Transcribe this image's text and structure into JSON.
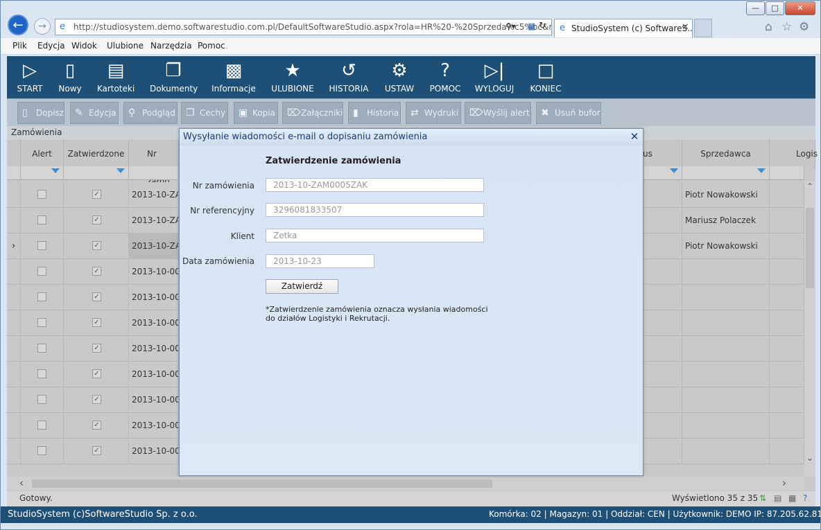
{
  "browser": {
    "url": "http://studiosystem.demo.softwarestudio.com.pl/DefaultSoftwareStudio.aspx?rola=HR%20-%20Sprzeda%c5%bc&rol",
    "tab_title": "StudioSystem (c) SoftwareS...",
    "menu": [
      "Plik",
      "Edycja",
      "Widok",
      "Ulubione",
      "Narzędzia",
      "Pomoc"
    ]
  },
  "toolbar": {
    "items": [
      {
        "label": "START",
        "icon": "play-icon"
      },
      {
        "label": "Nowy",
        "icon": "new-document-icon"
      },
      {
        "label": "Kartoteki",
        "icon": "window-list-icon"
      },
      {
        "label": "Dokumenty",
        "icon": "documents-icon"
      },
      {
        "label": "Informacje",
        "icon": "bar-chart-icon"
      },
      {
        "label": "ULUBIONE",
        "icon": "star-icon"
      },
      {
        "label": "HISTORIA",
        "icon": "history-icon"
      },
      {
        "label": "USTAW",
        "icon": "gears-icon"
      },
      {
        "label": "POMOC",
        "icon": "question-icon"
      },
      {
        "label": "WYLOGUJ",
        "icon": "logout-icon"
      },
      {
        "label": "KONIEC",
        "icon": "end-icon"
      }
    ]
  },
  "actions": [
    {
      "label": "Dopisz",
      "icon": "page-icon"
    },
    {
      "label": "Edycja",
      "icon": "edit-icon"
    },
    {
      "label": "Podgląd",
      "icon": "magnifier-icon"
    },
    {
      "label": "Cechy",
      "icon": "features-icon"
    },
    {
      "label": "Kopia",
      "icon": "copy-icon"
    },
    {
      "label": "Załączniki",
      "icon": "paperclip-icon"
    },
    {
      "label": "Historia",
      "icon": "history-icon"
    },
    {
      "label": "Wydruki",
      "icon": "print-icon"
    },
    {
      "label": "Wyślij alert",
      "icon": "alert-icon"
    },
    {
      "label": "Usuń bufor",
      "icon": "delete-icon"
    }
  ],
  "grid": {
    "breadcrumb": "Zamówienia",
    "columns": {
      "alert": "Alert",
      "approved": "Zatwierdzone",
      "order_no": "Nr zamó",
      "status": "us",
      "seller": "Sprzedawca",
      "logistics": "Logis"
    },
    "rows": [
      {
        "order": "2013-10-ZA",
        "seller": "Piotr Nowakowski"
      },
      {
        "order": "2013-10-ZA",
        "seller": "Mariusz Polaczek"
      },
      {
        "order": "2013-10-ZA",
        "seller": "Piotr Nowakowski"
      },
      {
        "order": "2013-10-00",
        "seller": ""
      },
      {
        "order": "2013-10-00",
        "seller": ""
      },
      {
        "order": "2013-10-00",
        "seller": ""
      },
      {
        "order": "2013-10-00",
        "seller": ""
      },
      {
        "order": "2013-10-00",
        "seller": ""
      },
      {
        "order": "2013-10-00",
        "seller": ""
      },
      {
        "order": "2013-10-00",
        "seller": ""
      },
      {
        "order": "2013-10-00",
        "seller": ""
      }
    ]
  },
  "status": {
    "left": "Gotowy.",
    "right": "Wyświetlono 35 z 35"
  },
  "footer": {
    "left": "StudioSystem (c)SoftwareStudio Sp. z o.o.",
    "right": "Komórka: 02 | Magazyn: 01 | Oddział: CEN | Użytkownik: DEMO IP: 87.205.62.81"
  },
  "dialog": {
    "title": "Wysyłanie wiadomości e-mail o dopisaniu zamówienia",
    "heading": "Zatwierdzenie zamówienia",
    "fields": {
      "order_label": "Nr zamówienia",
      "order_value": "2013-10-ZAM0005ZAK",
      "ref_label": "Nr referencyjny",
      "ref_value": "3296081833507",
      "client_label": "Klient",
      "client_value": "Zetka",
      "date_label": "Data zamówienia",
      "date_value": "2013-10-23"
    },
    "button": "Zatwierdź",
    "note_line1": "*Zatwierdzenie zamówienia oznacza wysłania wiadomości",
    "note_line2": "do działów Logistyki i Rekrutacji."
  }
}
